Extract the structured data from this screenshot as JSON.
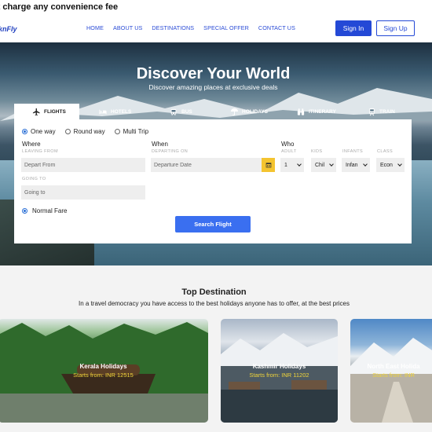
{
  "topbar": {
    "text": "'t charge any convenience fee"
  },
  "nav": {
    "logo": "knFly",
    "links": [
      "HOME",
      "ABOUT US",
      "DESTINATIONS",
      "SPECIAL OFFER",
      "CONTACT US"
    ],
    "signin": "Sign In",
    "signup": "Sign Up",
    "accent": "#2449d6"
  },
  "hero": {
    "title": "Discover Your World",
    "subtitle": "Discover amazing places at exclusive deals"
  },
  "tabs": [
    {
      "label": "FLIGHTS",
      "icon": "plane-icon",
      "active": true
    },
    {
      "label": "HOTELS",
      "icon": "bed-icon"
    },
    {
      "label": "BUS",
      "icon": "bus-icon"
    },
    {
      "label": "HOLIDAYS",
      "icon": "umbrella-icon"
    },
    {
      "label": "ITINERARY",
      "icon": "binoculars-icon"
    },
    {
      "label": "TRAIN",
      "icon": "train-icon"
    }
  ],
  "search": {
    "trip_types": [
      "One way",
      "Round way",
      "Multi Trip"
    ],
    "selected_trip": "One way",
    "where_label": "Where",
    "leaving_from_label": "LEAVING FROM",
    "leaving_from_placeholder": "Depart From",
    "going_to_label": "GOING TO",
    "going_to_placeholder": "Going to",
    "when_label": "When",
    "departing_on_label": "DEPARTING ON",
    "departure_placeholder": "Departure Date",
    "who_label": "Who",
    "adult_label": "ADULT",
    "adult_value": "1",
    "kids_label": "KIDS",
    "kids_value": "Chil",
    "infants_label": "INFANTS",
    "infants_value": "Infan",
    "class_label": "CLASS",
    "class_value": "Econ",
    "fare": "Normal Fare",
    "button": "Search Flight",
    "button_color": "#3a6ff0"
  },
  "destinations": {
    "title": "Top Destination",
    "subtitle": "In a travel democracy you have access to the best holidays anyone has to offer, at the best prices",
    "cards": [
      {
        "name": "Kerala Holidays",
        "price": "Starts from: INR 12515"
      },
      {
        "name": "Kashmir Holidays",
        "price": "Starts from: INR 11202"
      },
      {
        "name": "North East Holida",
        "price": "Starts from: INR"
      }
    ]
  }
}
